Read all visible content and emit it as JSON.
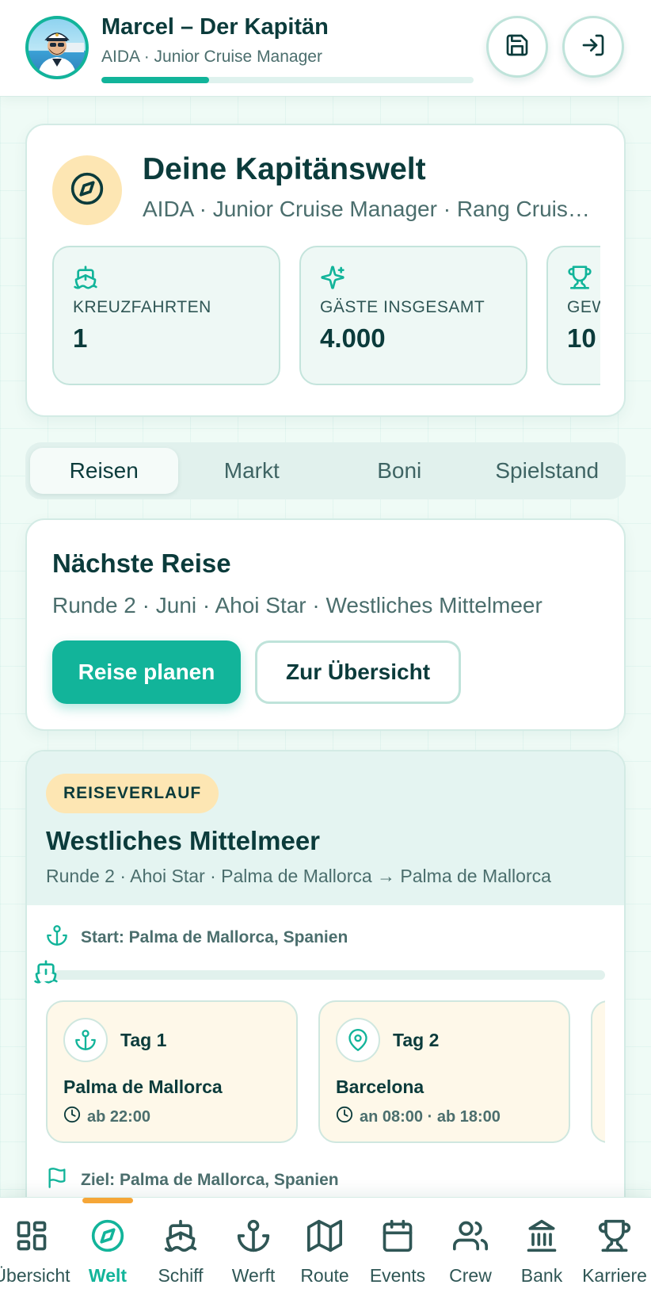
{
  "header": {
    "title": "Marcel – Der Kapitän",
    "subtitle": "AIDA · Junior Cruise Manager",
    "xp_progress": 0.29,
    "save_icon": "save-icon",
    "logout_icon": "log-in-icon"
  },
  "hero": {
    "title": "Deine Kapitänswelt",
    "subtitle": "AIDA · Junior Cruise Manager · Rang Cruise R...",
    "stats": [
      {
        "label": "KREUZFAHRTEN",
        "value": "1",
        "icon": "ship-icon"
      },
      {
        "label": "GÄSTE INSGESAMT",
        "value": "4.000",
        "icon": "sparkles-icon"
      },
      {
        "label": "GEW",
        "value": "10",
        "icon": "trophy-icon"
      }
    ]
  },
  "tabs": [
    {
      "label": "Reisen",
      "active": true
    },
    {
      "label": "Markt",
      "active": false
    },
    {
      "label": "Boni",
      "active": false
    },
    {
      "label": "Spielstand",
      "active": false
    }
  ],
  "next_trip": {
    "title": "Nächste Reise",
    "subtitle": "Runde 2 · Juni · Ahoi Star · Westliches Mittelmeer",
    "plan_button": "Reise planen",
    "overview_button": "Zur Übersicht"
  },
  "route": {
    "badge": "REISEVERLAUF",
    "title": "Westliches Mittelmeer",
    "subtitle": "Runde 2 · Ahoi Star · Palma de Mallorca → Palma de Mallorca",
    "start": "Start: Palma de Mallorca, Spanien",
    "destination": "Ziel: Palma de Mallorca, Spanien",
    "progress": 0,
    "days": [
      {
        "label": "Tag 1",
        "city": "Palma de Mallorca",
        "time": "ab 22:00",
        "icon": "anchor-icon"
      },
      {
        "label": "Tag 2",
        "city": "Barcelona",
        "time": "an 08:00 · ab 18:00",
        "icon": "map-pin-icon"
      },
      {
        "label": "",
        "city": "",
        "time": "",
        "icon": ""
      }
    ]
  },
  "nav": [
    {
      "label": "Übersicht",
      "icon": "dashboard-icon",
      "active": false
    },
    {
      "label": "Welt",
      "icon": "compass-icon",
      "active": true
    },
    {
      "label": "Schiff",
      "icon": "ship-icon",
      "active": false
    },
    {
      "label": "Werft",
      "icon": "anchor-icon",
      "active": false
    },
    {
      "label": "Route",
      "icon": "map-icon",
      "active": false
    },
    {
      "label": "Events",
      "icon": "calendar-icon",
      "active": false
    },
    {
      "label": "Crew",
      "icon": "users-icon",
      "active": false
    },
    {
      "label": "Bank",
      "icon": "bank-icon",
      "active": false
    },
    {
      "label": "Karriere",
      "icon": "trophy-icon",
      "active": false
    }
  ],
  "colors": {
    "accent": "#12b49a",
    "dark_text": "#0b3b3b",
    "badge_bg": "#fde6b3",
    "nav_indicator": "#f5a637"
  }
}
